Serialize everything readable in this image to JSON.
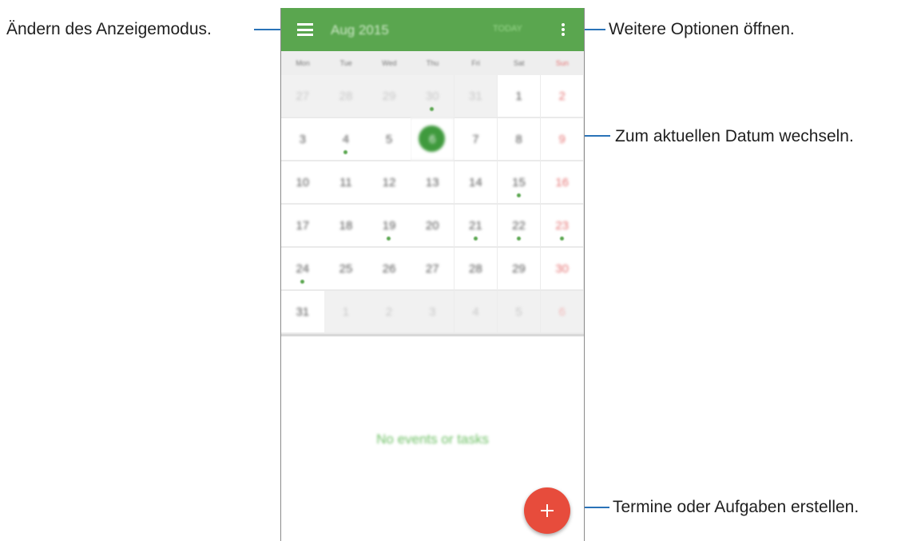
{
  "callouts": {
    "view_mode": "Ändern des Anzeigemodus.",
    "more_options": "Weitere Optionen öffnen.",
    "today": "Zum aktuellen Datum wechseln.",
    "create": "Termine oder Aufgaben erstellen."
  },
  "app": {
    "month_title": "Aug 2015",
    "today_label": "TODAY",
    "menu_icon": "hamburger-menu-icon",
    "more_icon": "vertical-dots-icon",
    "fab_icon": "plus-icon",
    "accent_color": "#5aa64f",
    "fab_color": "#e74c3c"
  },
  "weekdays": [
    "Mon",
    "Tue",
    "Wed",
    "Thu",
    "Fri",
    "Sat",
    "Sun"
  ],
  "calendar": {
    "rows": [
      [
        {
          "d": "27",
          "o": true
        },
        {
          "d": "28",
          "o": true
        },
        {
          "d": "29",
          "o": true
        },
        {
          "d": "30",
          "o": true,
          "e": true
        },
        {
          "d": "31",
          "o": true
        },
        {
          "d": "1"
        },
        {
          "d": "2"
        }
      ],
      [
        {
          "d": "3"
        },
        {
          "d": "4",
          "e": true
        },
        {
          "d": "5"
        },
        {
          "d": "6",
          "t": true
        },
        {
          "d": "7"
        },
        {
          "d": "8"
        },
        {
          "d": "9"
        }
      ],
      [
        {
          "d": "10"
        },
        {
          "d": "11"
        },
        {
          "d": "12"
        },
        {
          "d": "13"
        },
        {
          "d": "14"
        },
        {
          "d": "15",
          "e": true
        },
        {
          "d": "16"
        }
      ],
      [
        {
          "d": "17"
        },
        {
          "d": "18"
        },
        {
          "d": "19",
          "e": true
        },
        {
          "d": "20"
        },
        {
          "d": "21",
          "e": true
        },
        {
          "d": "22",
          "e": true
        },
        {
          "d": "23",
          "e": true
        }
      ],
      [
        {
          "d": "24",
          "e": true
        },
        {
          "d": "25"
        },
        {
          "d": "26"
        },
        {
          "d": "27"
        },
        {
          "d": "28"
        },
        {
          "d": "29"
        },
        {
          "d": "30"
        }
      ],
      [
        {
          "d": "31"
        },
        {
          "d": "1",
          "o": true
        },
        {
          "d": "2",
          "o": true
        },
        {
          "d": "3",
          "o": true
        },
        {
          "d": "4",
          "o": true
        },
        {
          "d": "5",
          "o": true
        },
        {
          "d": "6",
          "o": true
        }
      ]
    ]
  },
  "empty_state": "No events or tasks"
}
